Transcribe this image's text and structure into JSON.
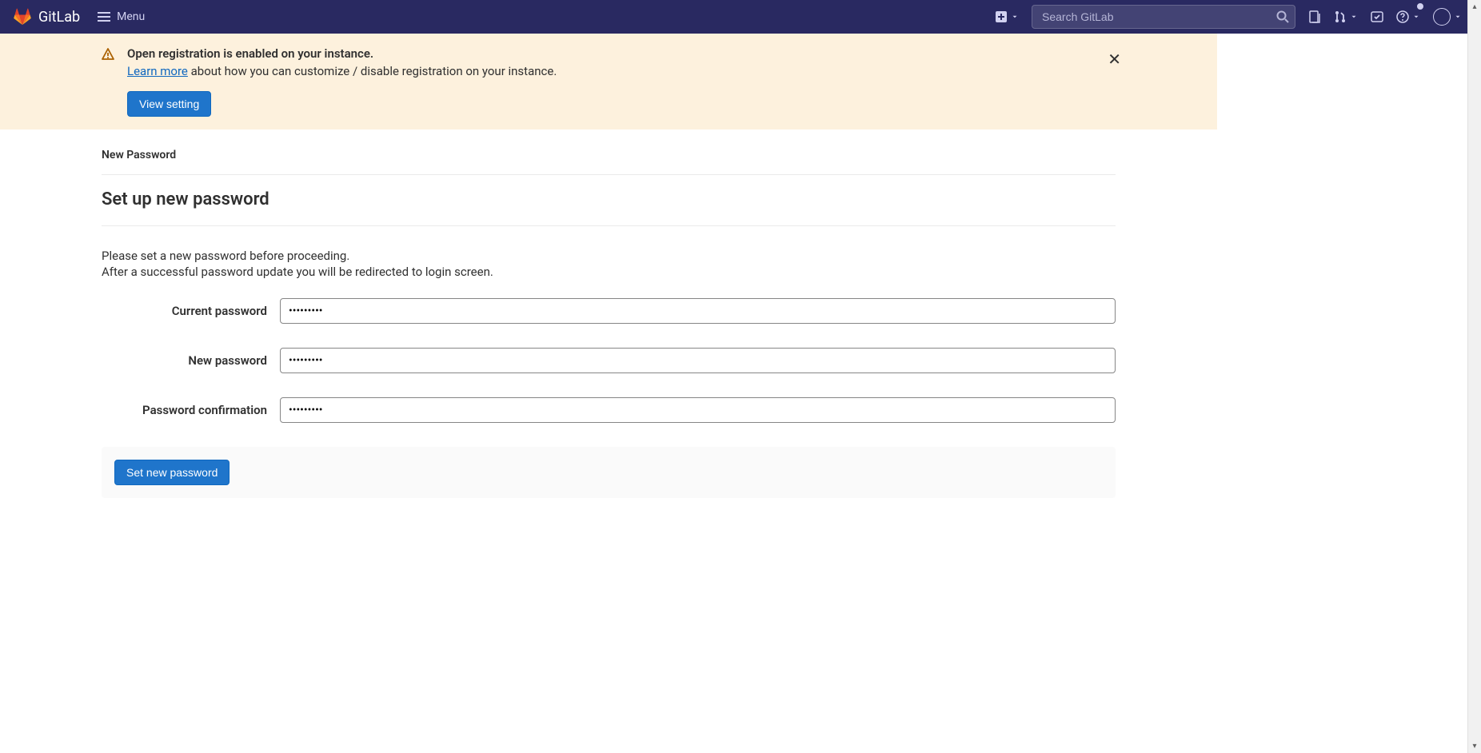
{
  "topbar": {
    "brand": "GitLab",
    "menu_label": "Menu",
    "search_placeholder": "Search GitLab"
  },
  "alert": {
    "title": "Open registration is enabled on your instance.",
    "link_text": "Learn more",
    "text_after": " about how you can customize / disable registration on your instance.",
    "button_label": "View setting"
  },
  "page": {
    "breadcrumb": "New Password",
    "heading": "Set up new password",
    "intro1": "Please set a new password before proceeding.",
    "intro2": "After a successful password update you will be redirected to login screen."
  },
  "form": {
    "current_label": "Current password",
    "current_value": "•••••••••",
    "new_label": "New password",
    "new_value": "•••••••••",
    "confirm_label": "Password confirmation",
    "confirm_value": "•••••••••",
    "submit_label": "Set new password"
  }
}
